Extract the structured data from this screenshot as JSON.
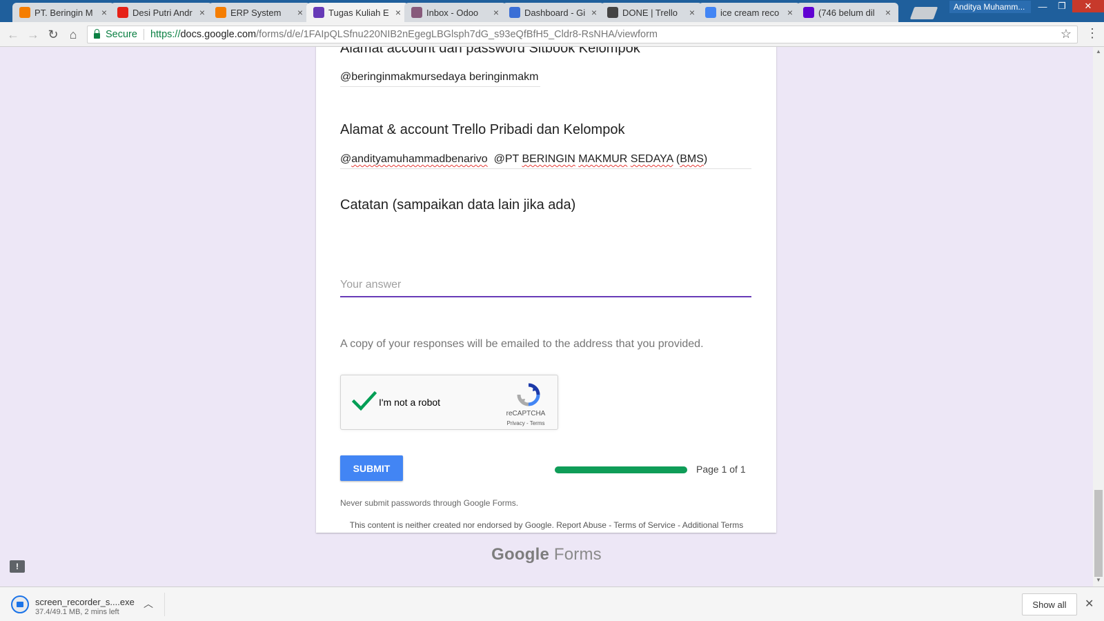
{
  "browser": {
    "tabs": [
      {
        "title": "PT. Beringin M",
        "favicon": "blogger-icon",
        "color": "#f57d00"
      },
      {
        "title": "Desi Putri Andr",
        "favicon": "youtube-icon",
        "color": "#e62117"
      },
      {
        "title": "ERP System",
        "favicon": "blogger-icon",
        "color": "#f57d00"
      },
      {
        "title": "Tugas Kuliah E",
        "favicon": "google-forms-icon",
        "color": "#673ab7"
      },
      {
        "title": "Inbox - Odoo",
        "favicon": "odoo-icon",
        "color": "#875a7b"
      },
      {
        "title": "Dashboard - Gi",
        "favicon": "gitkraken-icon",
        "color": "#3b6fd6"
      },
      {
        "title": "DONE | Trello",
        "favicon": "trello-icon",
        "color": "#444444"
      },
      {
        "title": "ice cream reco",
        "favicon": "google-icon",
        "color": "#4285f4"
      },
      {
        "title": "(746 belum dil",
        "favicon": "yahoo-mail-icon",
        "color": "#6001d2"
      }
    ],
    "active_tab_index": 3,
    "tab_close": "×",
    "profile_name": "Anditya Muhamm...",
    "window": {
      "minimize": "—",
      "maximize": "❐",
      "close": "✕"
    },
    "nav": {
      "back": "←",
      "forward": "→",
      "reload": "↻",
      "home": "⌂",
      "star": "☆",
      "menu": "⋮"
    },
    "security_label": "Secure",
    "url": {
      "scheme": "https://",
      "host": "docs.google.com",
      "path": "/forms/d/e/1FAIpQLSfnu220NIB2nEgegLBGlsph7dG_s93eQfBfH5_Cldr8-RsNHA/viewform"
    }
  },
  "form": {
    "partial_question": "Alamat account dan password Sitbook Kelompok",
    "partial_answer": "@beringinmakmursedaya beringinmakm",
    "trello": {
      "label": "Alamat & account Trello Pribadi dan Kelompok",
      "answer_parts": [
        "@",
        "andityamuhammadbenarivo",
        "  @PT ",
        "BERINGIN",
        " ",
        "MAKMUR",
        " ",
        "SEDAYA",
        " (",
        "BMS",
        ")"
      ]
    },
    "notes": {
      "label": "Catatan (sampaikan data lain jika ada)",
      "placeholder": "Your answer",
      "value": ""
    },
    "copy_note": "A copy of your responses will be emailed to the address that you provided.",
    "captcha": {
      "label": "I'm not a robot",
      "brand": "reCAPTCHA",
      "links": "Privacy - Terms",
      "checked": true
    },
    "submit_label": "SUBMIT",
    "progress": {
      "fraction": 1.0,
      "label": "Page 1 of 1",
      "color": "#0f9d58"
    },
    "warning": "Never submit passwords through Google Forms."
  },
  "footer": {
    "disclaimer": "This content is neither created nor endorsed by Google. Report Abuse - Terms of Service - Additional Terms",
    "brand_google": "Google",
    "brand_forms": "Forms"
  },
  "download": {
    "filename": "screen_recorder_s....exe",
    "status": "37.4/49.1 MB, 2 mins left",
    "show_all": "Show all",
    "close": "✕"
  },
  "theme": {
    "page_bg": "#ede7f6",
    "accent": "#673ab7",
    "submit_bg": "#4285f4",
    "tabstrip_bg": "#1f5f9c"
  }
}
